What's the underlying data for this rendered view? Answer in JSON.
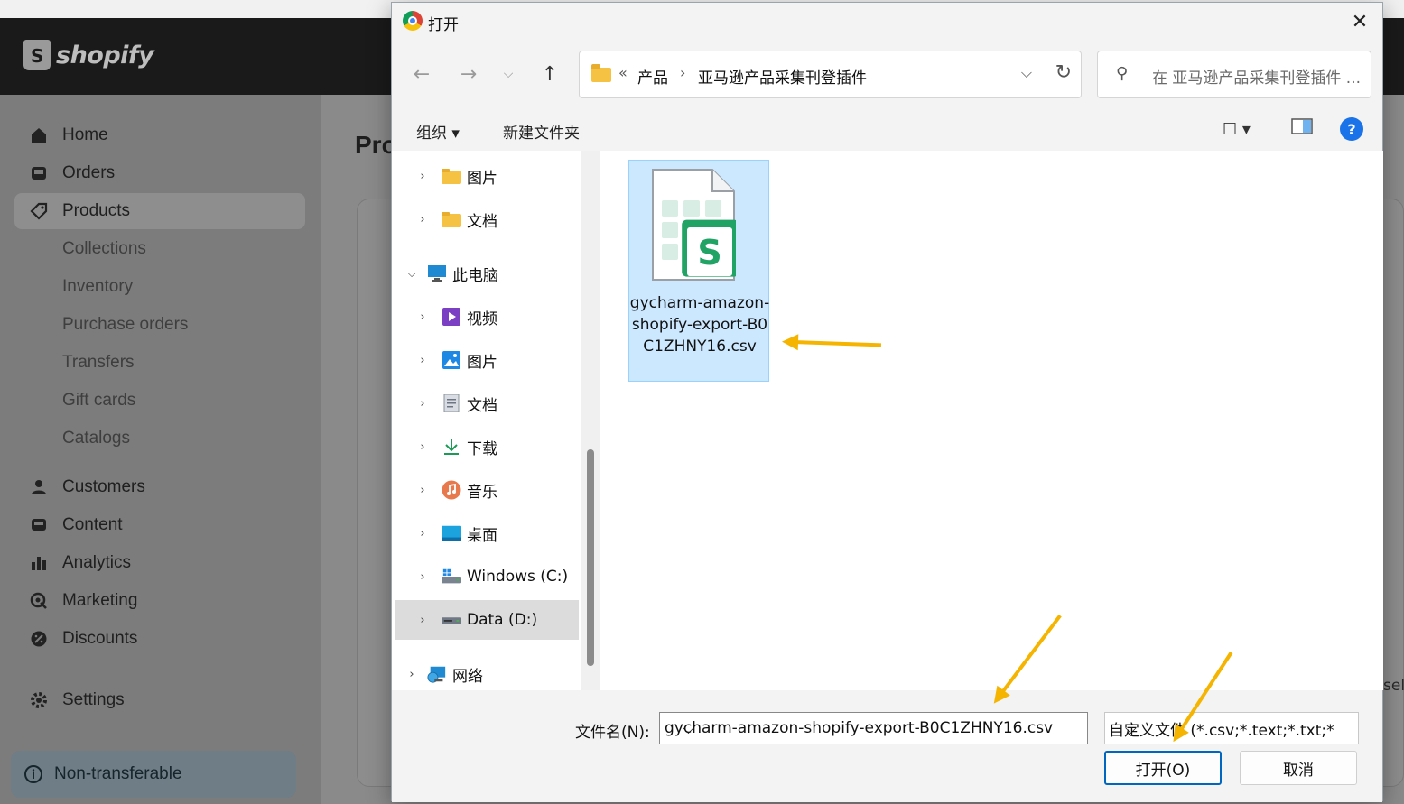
{
  "shopify": {
    "logo_text": "shopify",
    "page_title": "Pro",
    "edge_text": "sel",
    "nav": [
      {
        "label": "Home",
        "icon": "home-icon"
      },
      {
        "label": "Orders",
        "icon": "orders-icon"
      },
      {
        "label": "Products",
        "icon": "tag-icon",
        "active": true
      },
      {
        "label": "Collections"
      },
      {
        "label": "Inventory"
      },
      {
        "label": "Purchase orders"
      },
      {
        "label": "Transfers"
      },
      {
        "label": "Gift cards"
      },
      {
        "label": "Catalogs"
      },
      {
        "label": "Customers",
        "icon": "person-icon"
      },
      {
        "label": "Content",
        "icon": "content-icon"
      },
      {
        "label": "Analytics",
        "icon": "bar-chart-icon"
      },
      {
        "label": "Marketing",
        "icon": "marketing-icon"
      },
      {
        "label": "Discounts",
        "icon": "discount-icon"
      },
      {
        "label": "Settings",
        "icon": "gear-icon"
      }
    ],
    "badge": "Non-transferable"
  },
  "dialog": {
    "title": "打开",
    "breadcrumb": {
      "prefix": "«",
      "items": [
        "产品",
        "亚马逊产品采集刊登插件"
      ]
    },
    "search_placeholder": "在 亚马逊产品采集刊登插件 ...",
    "toolbar": {
      "organize": "组织 ▾",
      "new_folder": "新建文件夹",
      "help": "?"
    },
    "tree": [
      {
        "label": "图片",
        "icon": "folder-icon",
        "level": 1
      },
      {
        "label": "文档",
        "icon": "folder-icon",
        "level": 1
      },
      {
        "label": "此电脑",
        "icon": "computer-icon",
        "level": 0,
        "expanded": true
      },
      {
        "label": "视频",
        "icon": "video-icon",
        "level": 1
      },
      {
        "label": "图片",
        "icon": "picture-icon",
        "level": 1
      },
      {
        "label": "文档",
        "icon": "document-icon",
        "level": 1
      },
      {
        "label": "下载",
        "icon": "download-icon",
        "level": 1
      },
      {
        "label": "音乐",
        "icon": "music-icon",
        "level": 1
      },
      {
        "label": "桌面",
        "icon": "desktop-icon",
        "level": 1
      },
      {
        "label": "Windows (C:)",
        "icon": "drive-icon",
        "level": 1
      },
      {
        "label": "Data (D:)",
        "icon": "drive-icon",
        "level": 1,
        "selected": true
      },
      {
        "label": "网络",
        "icon": "network-icon",
        "level": 0
      }
    ],
    "file": {
      "name": "gycharm-amazon-shopify-export-B0C1ZHNY16.csv",
      "icon_letter": "S"
    },
    "filename_label": "文件名(N):",
    "filename_value": "gycharm-amazon-shopify-export-B0C1ZHNY16.csv",
    "filter_value": "自定义文件 (*.csv;*.text;*.txt;*.x",
    "open_button": "打开(O)",
    "cancel_button": "取消"
  },
  "colors": {
    "annotation_arrow": "#f5b400",
    "accent": "#0067c0",
    "selection": "#cce8ff",
    "sheet_green": "#21a366"
  }
}
